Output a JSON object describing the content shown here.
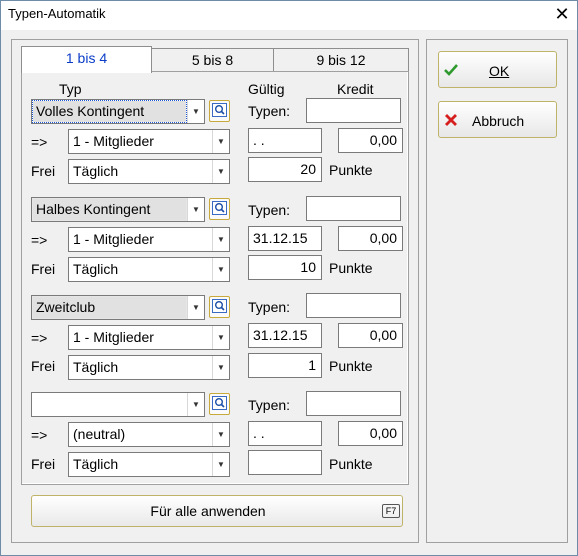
{
  "window": {
    "title": "Typen-Automatik"
  },
  "tabs": [
    "1 bis 4",
    "5 bis 8",
    "9 bis 12"
  ],
  "headers": {
    "typ": "Typ",
    "gueltig": "Gültig",
    "kredit": "Kredit"
  },
  "labels": {
    "typen": "Typen:",
    "arrow": "=>",
    "frei": "Frei",
    "punkte": "Punkte"
  },
  "rows": [
    {
      "type": "Volles Kontingent",
      "typen": "",
      "group": "1 - Mitglieder",
      "date": " .  .",
      "credit": "0,00",
      "frei": "Täglich",
      "points": "20"
    },
    {
      "type": "Halbes Kontingent",
      "typen": "",
      "group": "1 - Mitglieder",
      "date": "31.12.15",
      "credit": "0,00",
      "frei": "Täglich",
      "points": "10"
    },
    {
      "type": "Zweitclub",
      "typen": "",
      "group": "1 - Mitglieder",
      "date": "31.12.15",
      "credit": "0,00",
      "frei": "Täglich",
      "points": "1"
    },
    {
      "type": "",
      "typen": "",
      "group": "(neutral)",
      "date": " .  .",
      "credit": "0,00",
      "frei": "Täglich",
      "points": ""
    }
  ],
  "buttons": {
    "ok": "OK",
    "cancel": "Abbruch",
    "apply": "Für alle anwenden",
    "apply_key": "F7"
  },
  "colors": {
    "active_tab": "#0a3cc8",
    "ok_check": "#2e9a2e",
    "cancel_x": "#d62020"
  }
}
